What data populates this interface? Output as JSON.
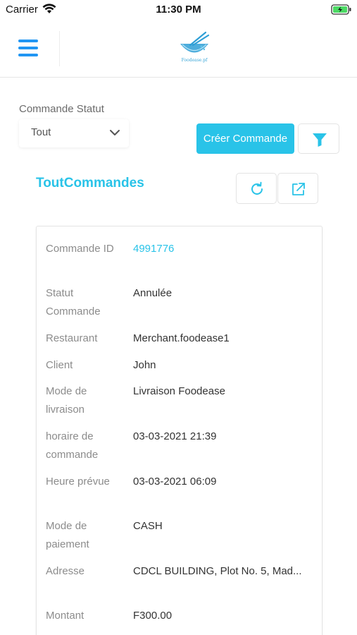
{
  "status_bar": {
    "carrier": "Carrier",
    "time": "11:30 PM",
    "wifi_icon": "wifi-icon",
    "battery_icon": "battery-charging-icon"
  },
  "header": {
    "menu_icon": "hamburger-menu-icon",
    "logo_text": "Foodease.pf"
  },
  "filter": {
    "label": "Commande Statut",
    "selected": "Tout",
    "create_button": "Créer Commande",
    "filter_icon": "filter-icon"
  },
  "section": {
    "title": "ToutCommandes",
    "refresh_icon": "refresh-icon",
    "export_icon": "external-link-icon"
  },
  "order": {
    "rows": [
      {
        "label": "Commande ID",
        "value": "4991776"
      },
      {
        "label": "Statut Commande",
        "value": "Annulée"
      },
      {
        "label": "Restaurant",
        "value": "Merchant.foodease1"
      },
      {
        "label": "Client",
        "value": "John"
      },
      {
        "label": "Mode de livraison",
        "value": "Livraison Foodease"
      },
      {
        "label": "horaire de commande",
        "value": "03-03-2021 21:39"
      },
      {
        "label": "Heure prévue",
        "value": "03-03-2021 06:09"
      },
      {
        "label": "Mode de paiement",
        "value": "CASH"
      },
      {
        "label": "Adresse",
        "value": "CDCL BUILDING, Plot No. 5, Mad..."
      },
      {
        "label": "Montant",
        "value": "F300.00"
      }
    ]
  },
  "colors": {
    "accent": "#29c3e8",
    "menu_blue": "#2196f3"
  }
}
